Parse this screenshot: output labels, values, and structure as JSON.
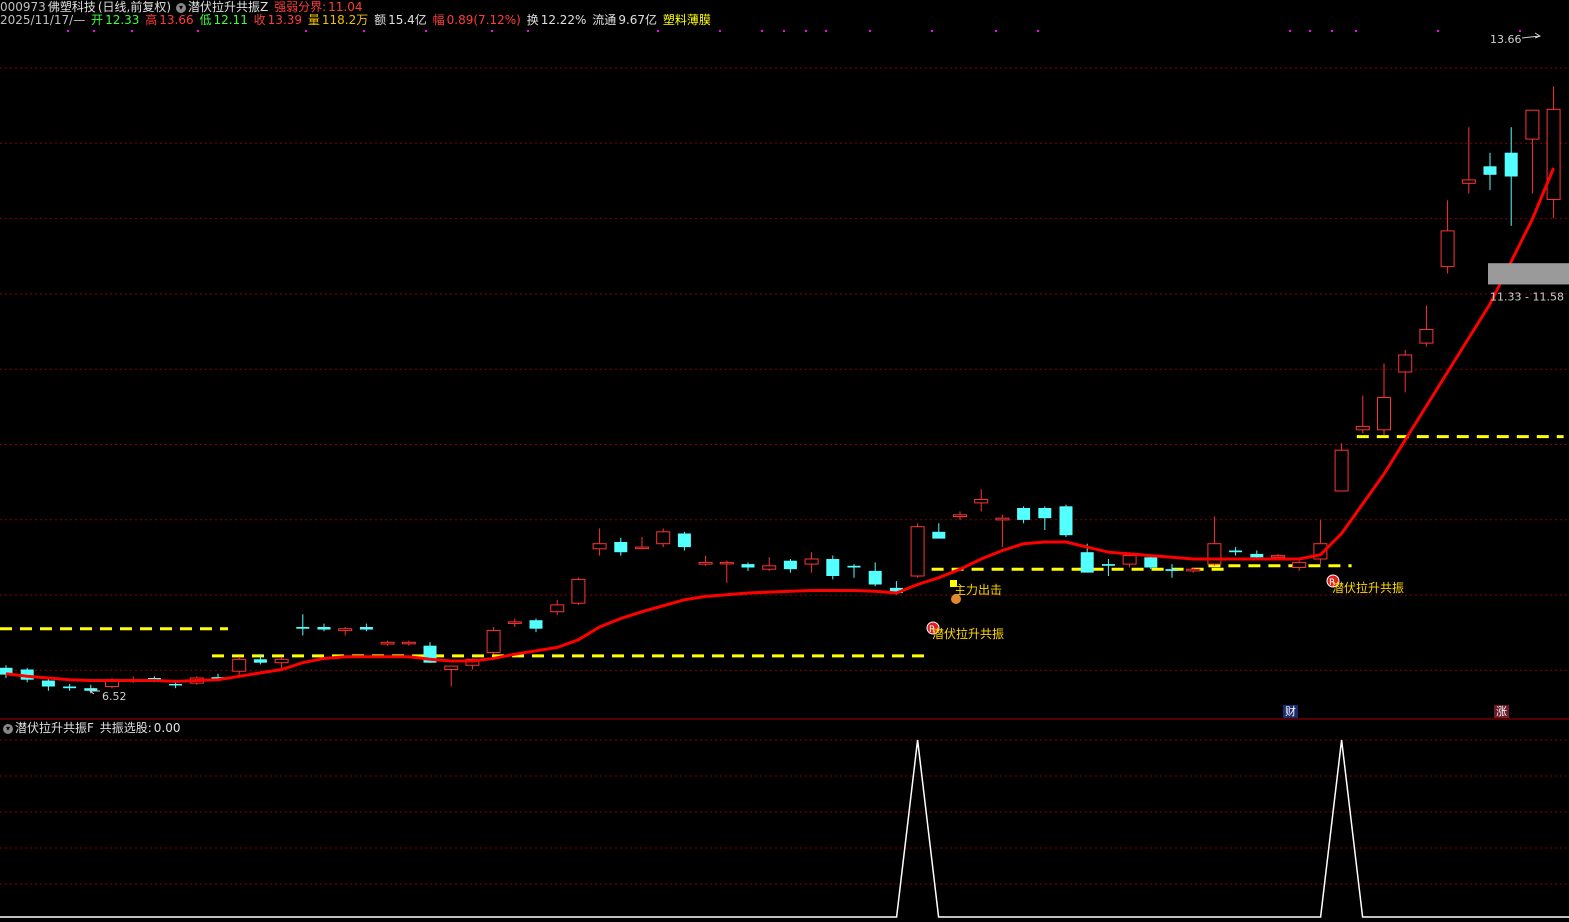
{
  "header": {
    "code": "000973",
    "name": "佛塑科技",
    "period": "(日线,前复权)",
    "indicator": "潜伏拉升共振Z",
    "strength_label": "强弱分界:",
    "strength_value": "11.04",
    "date": "2025/11/17/—",
    "open_label": "开",
    "open": "12.33",
    "high_label": "高",
    "high": "13.66",
    "low_label": "低",
    "low": "12.11",
    "close_label": "收",
    "close": "13.39",
    "vol_label": "量",
    "vol": "118.2万",
    "amount_label": "额",
    "amount": "15.4亿",
    "change_label": "幅",
    "change": "0.89(7.12%)",
    "turnover_label": "换",
    "turnover": "12.22%",
    "float_label": "流通",
    "float": "9.67亿",
    "sector": "塑料薄膜"
  },
  "annotations": {
    "high_label": "13.66",
    "low_label": "6.52",
    "range_label": "11.33 - 11.58",
    "signal1": "潜伏拉升共振",
    "signal2": "潜伏拉升共振",
    "main_force": "主力出击",
    "r_icon": "R",
    "badge_cai": "财",
    "badge_zhang": "涨"
  },
  "subpanel": {
    "indicator": "潜伏拉升共振F",
    "label": "共振选股:",
    "value": "0.00"
  },
  "colors": {
    "up": "#ff3232",
    "down": "#54ffff",
    "ma": "#ff0000",
    "dashed": "#ffff00",
    "grid": "#8b0000",
    "sub_line": "#ffffff"
  },
  "chart_data": {
    "type": "candlestick",
    "x": [
      1,
      2,
      3,
      4,
      5,
      6,
      7,
      8,
      9,
      10,
      11,
      12,
      13,
      14,
      15,
      16,
      17,
      18,
      19,
      20,
      21,
      22,
      23,
      24,
      25,
      26,
      27,
      28,
      29,
      30,
      31,
      32,
      33,
      34,
      35,
      36,
      37,
      38,
      39,
      40,
      41,
      42,
      43,
      44,
      45,
      46,
      47,
      48,
      49,
      50,
      51,
      52,
      53,
      54,
      55,
      56,
      57,
      58,
      59,
      60,
      61,
      62,
      63,
      64,
      65,
      66,
      67,
      68,
      69,
      70,
      71,
      72,
      73,
      74
    ],
    "ohlc": [
      [
        6.82,
        6.85,
        6.7,
        6.74
      ],
      [
        6.8,
        6.82,
        6.65,
        6.68
      ],
      [
        6.67,
        6.7,
        6.55,
        6.6
      ],
      [
        6.6,
        6.63,
        6.55,
        6.58
      ],
      [
        6.58,
        6.62,
        6.52,
        6.55
      ],
      [
        6.6,
        6.7,
        6.58,
        6.68
      ],
      [
        6.68,
        6.72,
        6.64,
        6.68
      ],
      [
        6.7,
        6.72,
        6.65,
        6.67
      ],
      [
        6.63,
        6.66,
        6.58,
        6.62
      ],
      [
        6.64,
        6.72,
        6.62,
        6.7
      ],
      [
        6.71,
        6.75,
        6.66,
        6.68
      ],
      [
        6.78,
        6.95,
        6.72,
        6.92
      ],
      [
        6.92,
        6.98,
        6.86,
        6.88
      ],
      [
        6.88,
        6.95,
        6.8,
        6.92
      ],
      [
        7.3,
        7.45,
        7.2,
        7.28
      ],
      [
        7.3,
        7.34,
        7.25,
        7.27
      ],
      [
        7.26,
        7.3,
        7.2,
        7.28
      ],
      [
        7.3,
        7.34,
        7.25,
        7.27
      ],
      [
        7.1,
        7.14,
        7.08,
        7.12
      ],
      [
        7.12,
        7.14,
        7.08,
        7.12
      ],
      [
        7.08,
        7.12,
        6.88,
        6.88
      ],
      [
        6.8,
        6.84,
        6.6,
        6.84
      ],
      [
        6.85,
        6.93,
        6.8,
        6.92
      ],
      [
        7.0,
        7.3,
        6.98,
        7.26
      ],
      [
        7.36,
        7.4,
        7.3,
        7.36
      ],
      [
        7.38,
        7.4,
        7.24,
        7.28
      ],
      [
        7.48,
        7.62,
        7.44,
        7.56
      ],
      [
        7.58,
        7.88,
        7.56,
        7.86
      ],
      [
        8.22,
        8.46,
        8.14,
        8.28
      ],
      [
        8.3,
        8.35,
        8.14,
        8.18
      ],
      [
        8.24,
        8.36,
        8.22,
        8.24
      ],
      [
        8.28,
        8.46,
        8.24,
        8.42
      ],
      [
        8.4,
        8.42,
        8.2,
        8.24
      ],
      [
        8.04,
        8.14,
        8.02,
        8.06
      ],
      [
        8.06,
        8.08,
        7.82,
        8.06
      ],
      [
        8.04,
        8.06,
        7.96,
        8.0
      ],
      [
        7.98,
        8.12,
        7.96,
        8.02
      ],
      [
        8.08,
        8.1,
        7.94,
        7.98
      ],
      [
        8.04,
        8.18,
        7.94,
        8.1
      ],
      [
        8.1,
        8.14,
        7.86,
        7.9
      ],
      [
        8.02,
        8.04,
        7.88,
        8.0
      ],
      [
        7.96,
        8.06,
        7.78,
        7.8
      ],
      [
        7.76,
        7.84,
        7.68,
        7.7
      ],
      [
        7.9,
        8.52,
        7.88,
        8.48
      ],
      [
        8.42,
        8.52,
        8.34,
        8.34
      ],
      [
        8.6,
        8.66,
        8.56,
        8.62
      ],
      [
        8.76,
        8.92,
        8.66,
        8.8
      ],
      [
        8.56,
        8.62,
        8.24,
        8.58
      ],
      [
        8.7,
        8.72,
        8.52,
        8.56
      ],
      [
        8.7,
        8.72,
        8.44,
        8.58
      ],
      [
        8.72,
        8.74,
        8.36,
        8.38
      ],
      [
        8.18,
        8.28,
        7.94,
        7.94
      ],
      [
        8.04,
        8.1,
        7.9,
        8.02
      ],
      [
        8.04,
        8.18,
        8.0,
        8.14
      ],
      [
        8.12,
        8.14,
        7.98,
        8.0
      ],
      [
        7.98,
        8.04,
        7.88,
        7.96
      ],
      [
        7.96,
        8.0,
        7.94,
        7.98
      ],
      [
        8.04,
        8.6,
        8.02,
        8.28
      ],
      [
        8.2,
        8.24,
        8.14,
        8.18
      ],
      [
        8.16,
        8.2,
        8.1,
        8.12
      ],
      [
        8.14,
        8.16,
        8.12,
        8.14
      ],
      [
        8.0,
        8.08,
        7.96,
        8.06
      ],
      [
        8.1,
        8.56,
        8.04,
        8.28
      ],
      [
        8.9,
        9.46,
        8.9,
        9.38
      ],
      [
        9.62,
        10.02,
        9.58,
        9.66
      ],
      [
        9.62,
        10.4,
        9.56,
        10.0
      ],
      [
        10.3,
        10.56,
        10.06,
        10.5
      ],
      [
        10.64,
        11.08,
        10.6,
        10.8
      ],
      [
        11.54,
        12.32,
        11.46,
        11.96
      ],
      [
        12.52,
        13.18,
        12.4,
        12.56
      ],
      [
        12.72,
        12.88,
        12.44,
        12.62
      ],
      [
        12.88,
        13.18,
        12.02,
        12.6
      ],
      [
        13.04,
        13.36,
        12.4,
        13.38
      ],
      [
        12.33,
        13.66,
        12.11,
        13.39
      ]
    ],
    "ma": [
      6.75,
      6.72,
      6.7,
      6.68,
      6.67,
      6.67,
      6.67,
      6.67,
      6.66,
      6.67,
      6.68,
      6.72,
      6.76,
      6.8,
      6.88,
      6.93,
      6.95,
      6.95,
      6.95,
      6.95,
      6.92,
      6.9,
      6.9,
      6.93,
      6.98,
      7.02,
      7.06,
      7.15,
      7.3,
      7.4,
      7.48,
      7.55,
      7.62,
      7.66,
      7.68,
      7.7,
      7.71,
      7.72,
      7.73,
      7.73,
      7.73,
      7.72,
      7.7,
      7.8,
      7.88,
      7.98,
      8.1,
      8.2,
      8.28,
      8.3,
      8.3,
      8.24,
      8.18,
      8.16,
      8.14,
      8.12,
      8.1,
      8.1,
      8.1,
      8.1,
      8.1,
      8.1,
      8.15,
      8.4,
      8.75,
      9.1,
      9.5,
      9.9,
      10.3,
      10.7,
      11.1,
      11.6,
      12.1,
      12.7
    ],
    "support_levels": [
      {
        "from": 1,
        "to": 11,
        "value": 7.28
      },
      {
        "from": 11,
        "to": 44,
        "value": 6.96
      },
      {
        "from": 44,
        "to": 58,
        "value": 7.98
      },
      {
        "from": 58,
        "to": 64,
        "value": 8.02
      },
      {
        "from": 65,
        "to": 74,
        "value": 9.54
      }
    ],
    "subpanel_signal": [
      0,
      0,
      0,
      0,
      0,
      0,
      0,
      0,
      0,
      0,
      0,
      0,
      0,
      0,
      0,
      0,
      0,
      0,
      0,
      0,
      0,
      0,
      0,
      0,
      0,
      0,
      0,
      0,
      0,
      0,
      0,
      0,
      0,
      0,
      0,
      0,
      0,
      0,
      0,
      0,
      0,
      0,
      0,
      1,
      0,
      0,
      0,
      0,
      0,
      0,
      0,
      0,
      0,
      0,
      0,
      0,
      0,
      0,
      0,
      0,
      0,
      0,
      0,
      1,
      0,
      0,
      0,
      0,
      0,
      0,
      0,
      0,
      0,
      0
    ],
    "ylim": [
      6.3,
      14.3
    ]
  }
}
